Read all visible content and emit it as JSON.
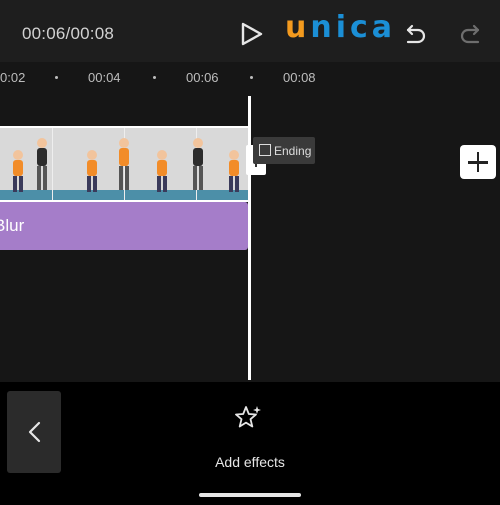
{
  "topbar": {
    "time": "00:06/00:08",
    "logo_first": "u",
    "logo_rest": "nica"
  },
  "ruler": {
    "ticks": [
      "0:02",
      "00:04",
      "00:06",
      "00:08"
    ]
  },
  "ending": {
    "label": "Ending"
  },
  "effect_track": {
    "label": "Blur"
  },
  "bottom": {
    "add_effects_label": "Add effects"
  },
  "colors": {
    "effect_track": "#a57dc9",
    "logo_orange": "#f39a1e",
    "logo_blue": "#1b8fd6"
  },
  "icons": [
    "play-icon",
    "undo-icon",
    "redo-icon",
    "plus-icon",
    "chevron-left-icon",
    "star-effects-icon"
  ]
}
